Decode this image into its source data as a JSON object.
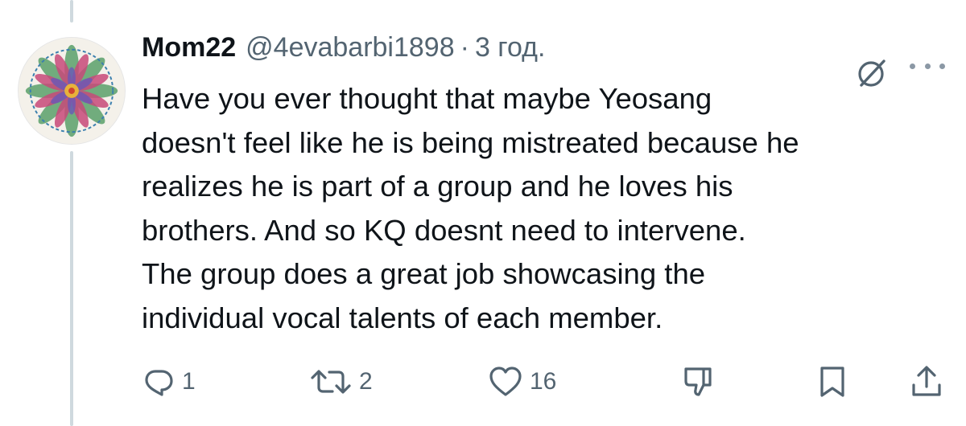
{
  "post": {
    "author_name": "Mom22",
    "handle": "@4evabarbi1898",
    "separator": "·",
    "time": "3 год.",
    "text": "Have you ever thought that maybe Yeosang\ndoesn't feel like he is being mistreated because he\nrealizes he is part of a group and he loves his\nbrothers. And so KQ doesnt need to intervene.\nThe group does a great job showcasing the\nindividual vocal talents of each member."
  },
  "actions": {
    "reply_count": "1",
    "repost_count": "2",
    "like_count": "16"
  },
  "icons": {
    "reply": "reply-icon",
    "repost": "repost-icon",
    "like": "heart-icon",
    "dislike": "thumbs-down-icon",
    "bookmark": "bookmark-icon",
    "share": "share-icon",
    "grok": "grok-icon",
    "more": "more-icon"
  },
  "colors": {
    "text": "#0f1419",
    "secondary": "#536471",
    "thread_line": "#cfd9de"
  }
}
